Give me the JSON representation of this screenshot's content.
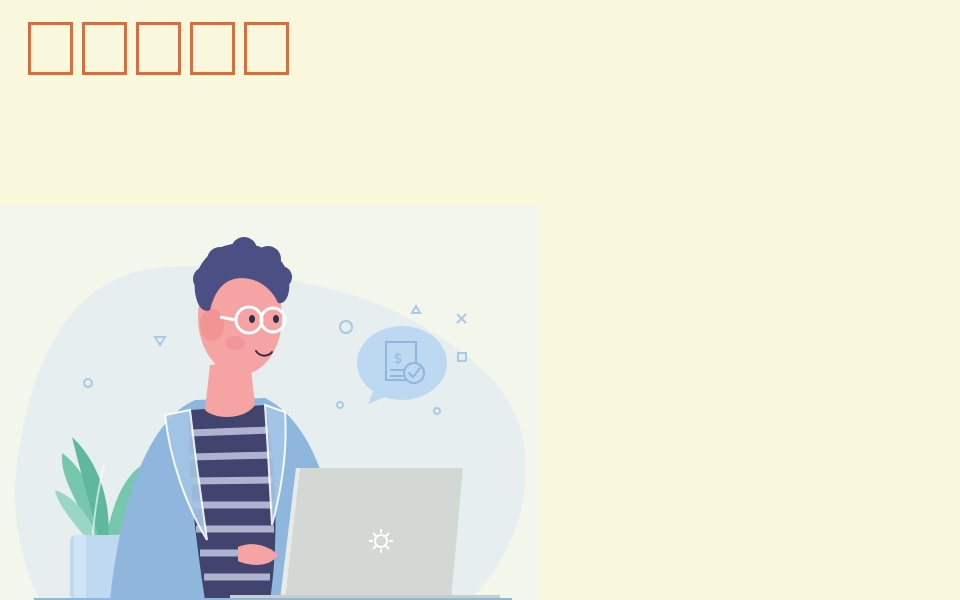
{
  "title": {
    "glyph_count": 5,
    "color": "#e06a3a"
  },
  "illustration": {
    "subject": "person-working-on-laptop",
    "speech_bubble_symbol": "$",
    "colors": {
      "background": "#f9f8dd",
      "panel": "#f3f6ea",
      "blob": "#e6eef0",
      "hair": "#4c4f83",
      "skin": "#f6a3a4",
      "jacket": "#8fb6dc",
      "shirt_stripe_dark": "#40446f",
      "laptop": "#d4d8d4",
      "plant": "#77c7ad",
      "pot": "#bfd9f0",
      "bubble": "#bcd9f1"
    }
  }
}
